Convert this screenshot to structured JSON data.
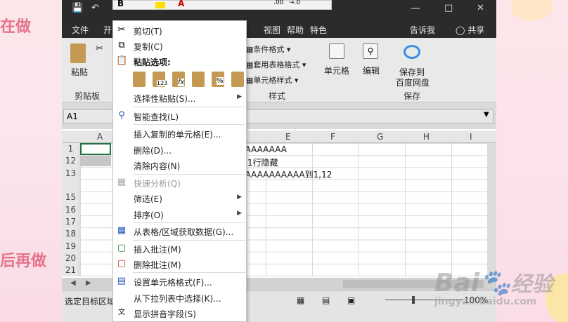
{
  "background": {
    "left_text_1": "在做",
    "left_text_2": "后再做"
  },
  "window": {
    "title_partial": "-",
    "title_partial_2": "-",
    "minimize_icon": "minimize-icon",
    "restore_icon": "restore-icon",
    "close_icon": "close-icon"
  },
  "quick_access": {
    "save_icon": "save-icon",
    "undo_icon": "undo-icon",
    "format_bold": "B",
    "num_format_1": ".00",
    "num_format_2": "→.0"
  },
  "tabs": [
    "文件",
    "开",
    "视图",
    "帮助",
    "特色",
    "告诉我",
    "共享"
  ],
  "ribbon": {
    "clipboard": {
      "paste_label": "粘贴",
      "group_label": "剪贴板"
    },
    "styles": {
      "conditional_format": "条件格式",
      "table_format": "套用表格格式",
      "cell_styles": "单元格样式",
      "group_label": "样式"
    },
    "cells": {
      "label": "单元格"
    },
    "editing": {
      "label": "编辑"
    },
    "save": {
      "label_1": "保存到",
      "label_2": "百度网盘",
      "group_label": "保存"
    }
  },
  "formula_bar": {
    "name_box": "A1",
    "dropdown_icon": "chevron-down-icon"
  },
  "columns": [
    "A",
    "E",
    "F",
    "G",
    "H",
    "I"
  ],
  "rows": [
    "1",
    "12",
    "13",
    "15",
    "16",
    "17",
    "18",
    "19",
    "20",
    "21"
  ],
  "cells": {
    "r1": "AAAAAAAA",
    "r12": "-11行隐藏",
    "r13": "AAAAAAAAAAA到1,12"
  },
  "status": {
    "mode": "选定目标区域",
    "zoom": "100%"
  },
  "context_menu": {
    "items": [
      {
        "label": "剪切(T)",
        "icon": "scissors-icon"
      },
      {
        "label": "复制(C)",
        "icon": "copy-icon"
      },
      {
        "label": "粘贴选项:",
        "icon": "paste-icon"
      },
      {
        "label": "选择性粘贴(S)...",
        "icon": ""
      },
      {
        "label": "智能查找(L)",
        "icon": "search-icon"
      },
      {
        "label": "插入复制的单元格(E)...",
        "icon": ""
      },
      {
        "label": "删除(D)...",
        "icon": ""
      },
      {
        "label": "清除内容(N)",
        "icon": ""
      },
      {
        "label": "快速分析(Q)",
        "icon": "quick-analysis-icon"
      },
      {
        "label": "筛选(E)",
        "icon": ""
      },
      {
        "label": "排序(O)",
        "icon": ""
      },
      {
        "label": "从表格/区域获取数据(G)...",
        "icon": "table-icon"
      },
      {
        "label": "插入批注(M)",
        "icon": "new-comment-icon"
      },
      {
        "label": "删除批注(M)",
        "icon": "delete-comment-icon"
      },
      {
        "label": "设置单元格格式(F)...",
        "icon": "format-cells-icon"
      },
      {
        "label": "从下拉列表中选择(K)...",
        "icon": ""
      },
      {
        "label": "显示拼音字段(S)",
        "icon": "phonetic-icon"
      }
    ],
    "paste_option_labels": [
      "123",
      "fx",
      "%"
    ]
  },
  "watermark": {
    "text_1": "Bai",
    "text_2": "经验",
    "text_3": "jingyan.baidu.com"
  },
  "colors": {
    "accent": "#217346",
    "titlebar": "#2b2b2b",
    "ribbon": "#e9e9e9",
    "deco": "#e5748b"
  }
}
